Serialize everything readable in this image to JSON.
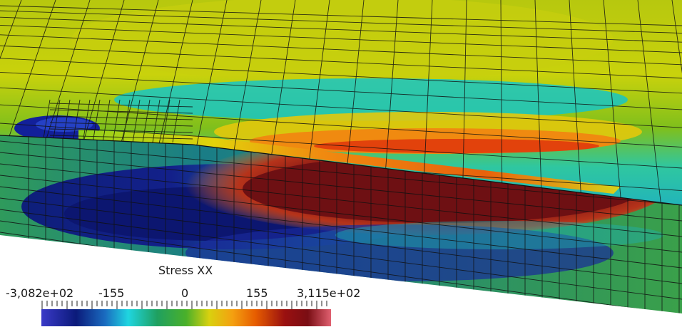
{
  "viewer": {
    "legend": {
      "title": "Stress XX",
      "tick_labels": [
        "-3,082e+02",
        "-155",
        "0",
        "155",
        "3,115e+02"
      ]
    },
    "colors": {
      "min": "#3a3ac8",
      "low": "#0b1a7a",
      "neutral": "#2e9a22",
      "mid": "#d9d10f",
      "high": "#e65c00",
      "max": "#e06070"
    }
  }
}
